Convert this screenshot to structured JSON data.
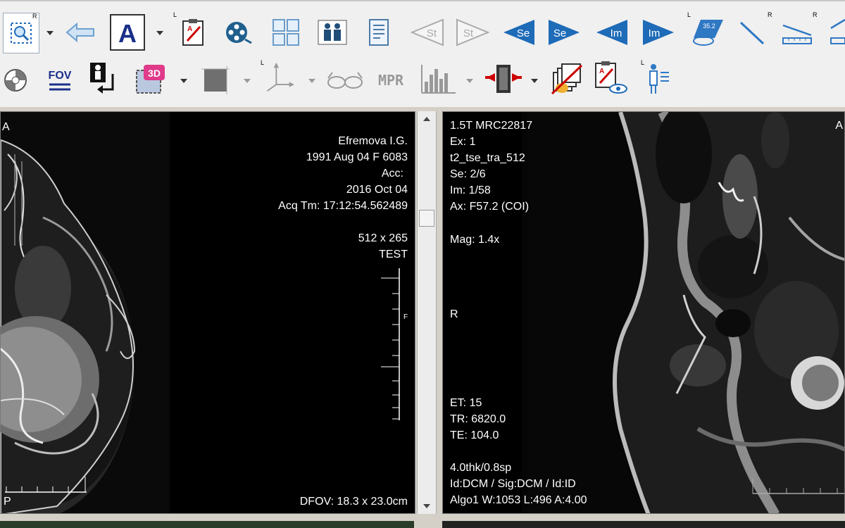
{
  "toolbar": {
    "row1": [
      {
        "name": "zoom-icon",
        "sup": "R"
      },
      {
        "name": "back-arrow-icon"
      },
      {
        "name": "annotation-text-icon"
      },
      {
        "name": "clipboard-annotate-icon",
        "sup": "L"
      },
      {
        "name": "film-reel-icon"
      },
      {
        "name": "layout-grid-icon"
      },
      {
        "name": "patients-icon"
      },
      {
        "name": "report-document-icon"
      },
      {
        "name": "study-prev-icon",
        "label": "St"
      },
      {
        "name": "study-next-icon",
        "label": "St"
      },
      {
        "name": "series-prev-icon",
        "label": "Se"
      },
      {
        "name": "series-next-icon",
        "label": "Se"
      },
      {
        "name": "image-prev-icon",
        "label": "Im"
      },
      {
        "name": "image-next-icon",
        "label": "Im"
      },
      {
        "name": "measure-angle-icon",
        "label": "35.2",
        "sup": "L"
      },
      {
        "name": "line-measure-icon",
        "sup": "R"
      },
      {
        "name": "ruler-icon",
        "sup": "R"
      },
      {
        "name": "ruler-alt-icon"
      }
    ],
    "row2": [
      {
        "name": "window-level-icon"
      },
      {
        "name": "fov-icon",
        "label": "FOV"
      },
      {
        "name": "patient-rotate-icon"
      },
      {
        "name": "3d-icon",
        "label": "3D"
      },
      {
        "name": "crop-icon"
      },
      {
        "name": "axis-icon",
        "sup": "L"
      },
      {
        "name": "glasses-icon"
      },
      {
        "name": "mpr-icon",
        "label": "MPR"
      },
      {
        "name": "histogram-icon"
      },
      {
        "name": "compare-icon"
      },
      {
        "name": "stack-hand-icon"
      },
      {
        "name": "clipboard-eye-icon"
      },
      {
        "name": "patient-info-icon",
        "sup": "L"
      }
    ]
  },
  "left_viewport": {
    "orientation_top": "A",
    "orientation_bottom": "P",
    "patient_name": "Efremova I.G.",
    "patient_line": "1991 Aug 04  F  6083",
    "acc": "Acc:",
    "date": "2016 Oct 04",
    "acq_time": "Acq Tm: 17:12:54.562489",
    "matrix": "512 x 265",
    "institution": "TEST",
    "scale_marker": "F",
    "dfov": "DFOV: 18.3 x 23.0cm"
  },
  "right_viewport": {
    "scanner": "1.5T MRC22817",
    "exam": "Ex: 1",
    "sequence": "t2_tse_tra_512",
    "series": "Se: 2/6",
    "image": "Im: 1/58",
    "axis": "Ax: F57.2 (COI)",
    "mag": "Mag: 1.4x",
    "orientation_left": "R",
    "orientation_right": "A",
    "et": "ET: 15",
    "tr": "TR: 6820.0",
    "te": "TE: 104.0",
    "thickness": "4.0thk/0.8sp",
    "ids": "Id:DCM / Sig:DCM / Id:ID",
    "window": "Algo1 W:1053  L:496  A:4.00"
  },
  "colors": {
    "accent_blue": "#1e6bb8",
    "viewport_bg": "#000000",
    "text": "#ffffff"
  }
}
